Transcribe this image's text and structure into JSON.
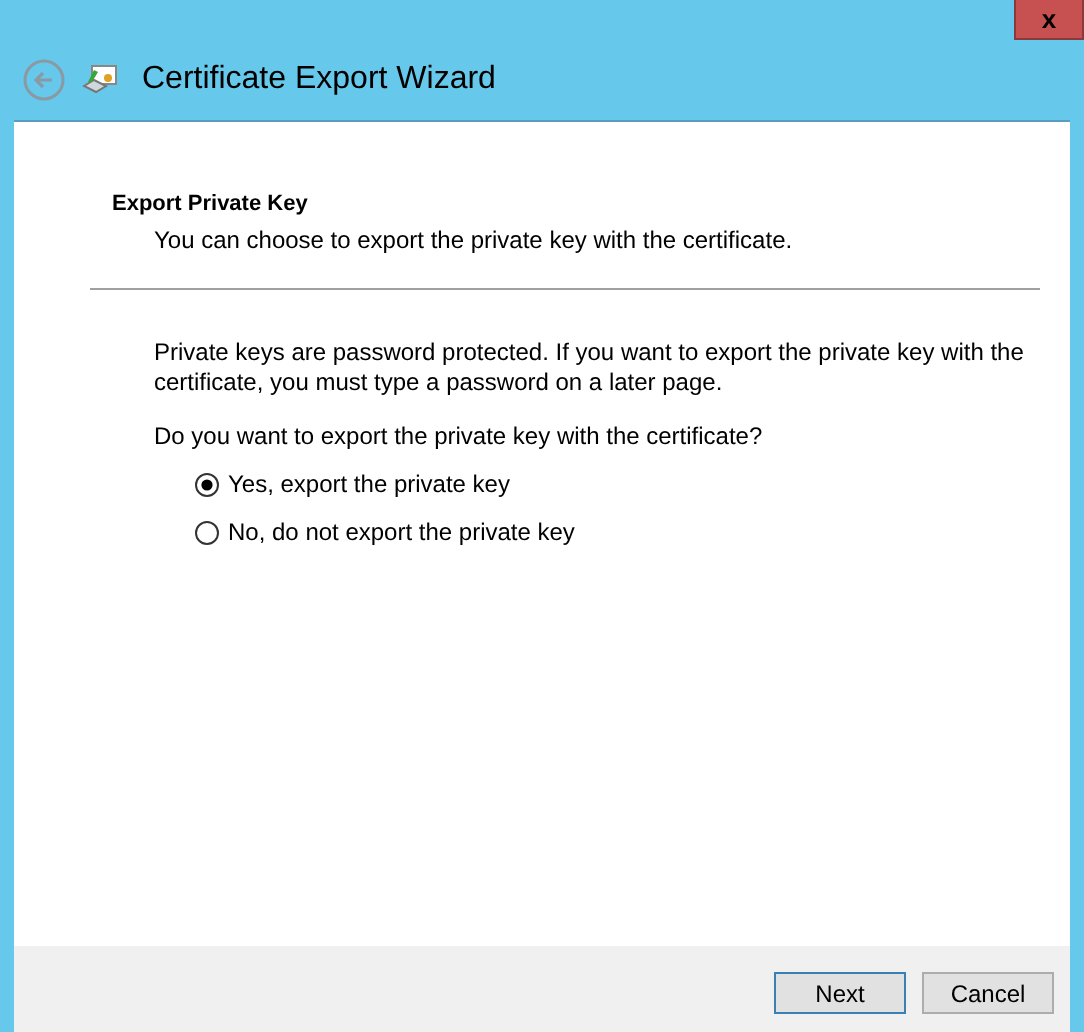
{
  "window": {
    "close": "x",
    "title": "Certificate Export Wizard"
  },
  "header": {
    "title": "Export Private Key",
    "subtitle": "You can choose to export the private key with the certificate."
  },
  "body": {
    "description": "Private keys are password protected. If you want to export the private key with the certificate, you must type a password on a later page.",
    "question": "Do you want to export the private key with the certificate?"
  },
  "options": [
    {
      "label": "Yes, export the private key",
      "selected": true
    },
    {
      "label": "No, do not export the private key",
      "selected": false
    }
  ],
  "buttons": [
    {
      "label": "Next",
      "default": true
    },
    {
      "label": "Cancel",
      "default": false
    }
  ]
}
